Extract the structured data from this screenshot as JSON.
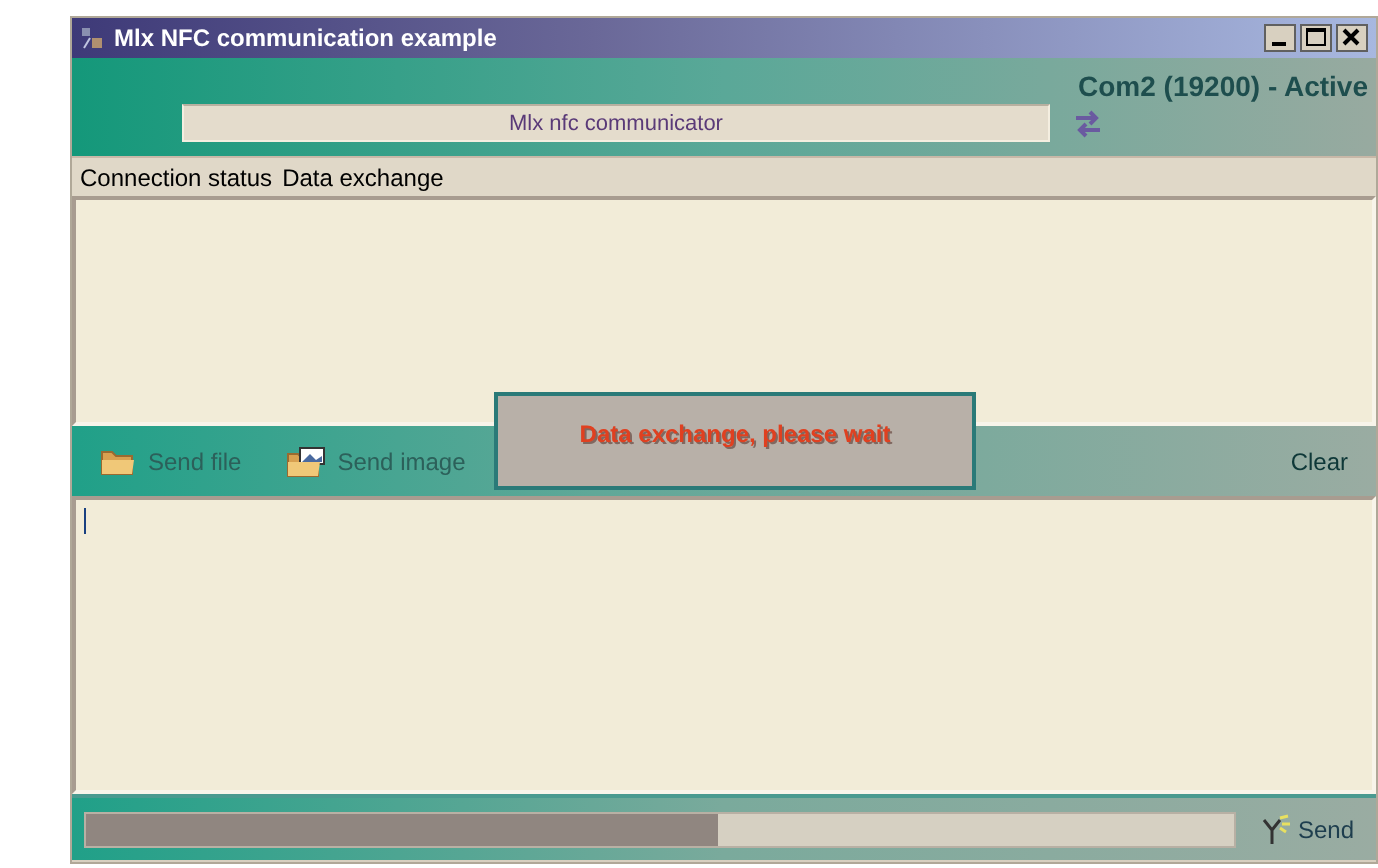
{
  "window": {
    "title": "Mlx NFC communication example"
  },
  "header": {
    "port_status": "Com2 (19200) - Active",
    "device_field": {
      "value": "Mlx nfc communicator"
    }
  },
  "menu": [
    {
      "label": "Connection status"
    },
    {
      "label": "Data exchange"
    }
  ],
  "toolbar": [
    {
      "label": "Send file",
      "kind": "file",
      "disabled": true
    },
    {
      "label": "Send image",
      "kind": "image",
      "disabled": true
    },
    {
      "label": "Clear",
      "kind": "clear",
      "disabled": false
    }
  ],
  "progress": {
    "level": 0.55
  },
  "send_button": {
    "label": "Send"
  },
  "dialog": {
    "message": "Data exchange, please wait"
  }
}
